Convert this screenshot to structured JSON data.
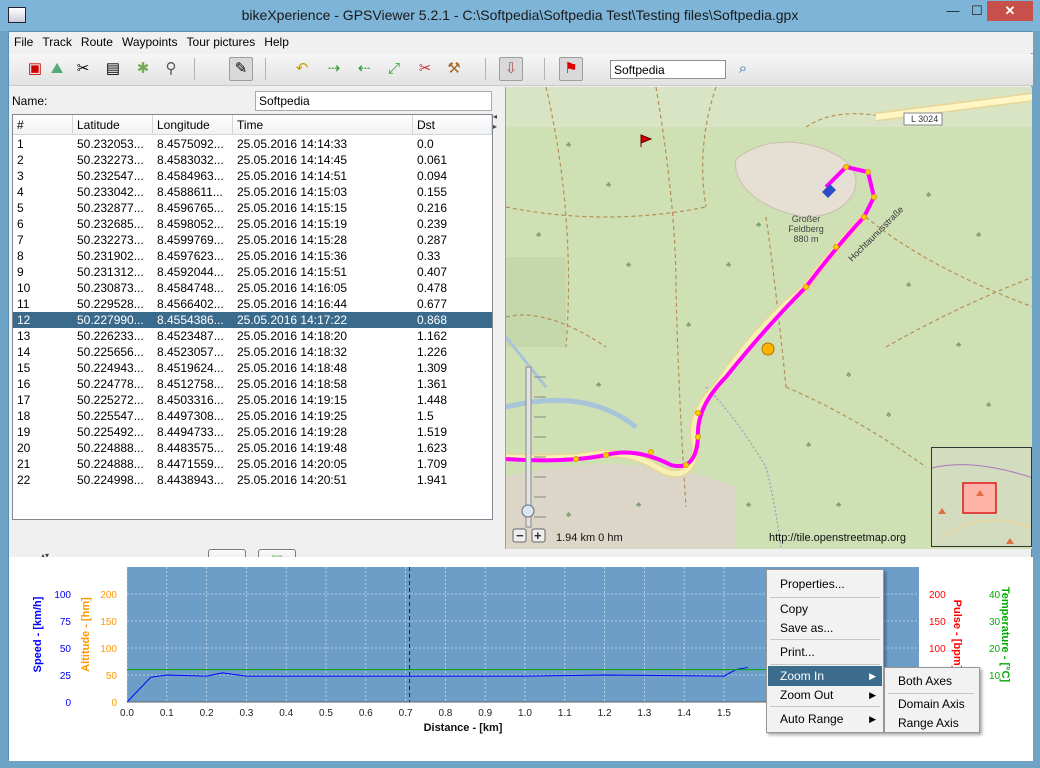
{
  "window": {
    "title": "bikeXperience - GPSViewer 5.2.1 - C:\\Softpedia\\Softpedia Test\\Testing files\\Softpedia.gpx",
    "minimize": "—",
    "maximize": "☐",
    "close": "✕"
  },
  "menubar": [
    "File",
    "Track",
    "Route",
    "Waypoints",
    "Tour pictures",
    "Help"
  ],
  "toolbar": {
    "search_value": "Softpedia"
  },
  "left_panel": {
    "name_label": "Name:",
    "name_value": "Softpedia"
  },
  "table": {
    "columns": [
      "#",
      "Latitude",
      "Longitude",
      "Time",
      "Dst"
    ],
    "selected_index": 11,
    "rows": [
      [
        "1",
        "50.232053...",
        "8.4575092...",
        "25.05.2016 14:14:33",
        "0.0"
      ],
      [
        "2",
        "50.232273...",
        "8.4583032...",
        "25.05.2016 14:14:45",
        "0.061"
      ],
      [
        "3",
        "50.232547...",
        "8.4584963...",
        "25.05.2016 14:14:51",
        "0.094"
      ],
      [
        "4",
        "50.233042...",
        "8.4588611...",
        "25.05.2016 14:15:03",
        "0.155"
      ],
      [
        "5",
        "50.232877...",
        "8.4596765...",
        "25.05.2016 14:15:15",
        "0.216"
      ],
      [
        "6",
        "50.232685...",
        "8.4598052...",
        "25.05.2016 14:15:19",
        "0.239"
      ],
      [
        "7",
        "50.232273...",
        "8.4599769...",
        "25.05.2016 14:15:28",
        "0.287"
      ],
      [
        "8",
        "50.231902...",
        "8.4597623...",
        "25.05.2016 14:15:36",
        "0.33"
      ],
      [
        "9",
        "50.231312...",
        "8.4592044...",
        "25.05.2016 14:15:51",
        "0.407"
      ],
      [
        "10",
        "50.230873...",
        "8.4584748...",
        "25.05.2016 14:16:05",
        "0.478"
      ],
      [
        "11",
        "50.229528...",
        "8.4566402...",
        "25.05.2016 14:16:44",
        "0.677"
      ],
      [
        "12",
        "50.227990...",
        "8.4554386...",
        "25.05.2016 14:17:22",
        "0.868"
      ],
      [
        "13",
        "50.226233...",
        "8.4523487...",
        "25.05.2016 14:18:20",
        "1.162"
      ],
      [
        "14",
        "50.225656...",
        "8.4523057...",
        "25.05.2016 14:18:32",
        "1.226"
      ],
      [
        "15",
        "50.224943...",
        "8.4519624...",
        "25.05.2016 14:18:48",
        "1.309"
      ],
      [
        "16",
        "50.224778...",
        "8.4512758...",
        "25.05.2016 14:18:58",
        "1.361"
      ],
      [
        "17",
        "50.225272...",
        "8.4503316...",
        "25.05.2016 14:19:15",
        "1.448"
      ],
      [
        "18",
        "50.225547...",
        "8.4497308...",
        "25.05.2016 14:19:25",
        "1.5"
      ],
      [
        "19",
        "50.225492...",
        "8.4494733...",
        "25.05.2016 14:19:28",
        "1.519"
      ],
      [
        "20",
        "50.224888...",
        "8.4483575...",
        "25.05.2016 14:19:48",
        "1.623"
      ],
      [
        "21",
        "50.224888...",
        "8.4471559...",
        "25.05.2016 14:20:05",
        "1.709"
      ],
      [
        "22",
        "50.224998...",
        "8.4438943...",
        "25.05.2016 14:20:51",
        "1.941"
      ]
    ]
  },
  "map": {
    "scale_label": "1.94 km 0 hm",
    "attribution": "http://tile.openstreetmap.org",
    "labels": {
      "peak": "Großer\nFeldberg\n880 m",
      "road": "L 3024",
      "street": "Hochtaunusstraße"
    }
  },
  "chart_data": {
    "type": "line",
    "xlabel": "Distance - [km]",
    "x_ticks": [
      "0.0",
      "0.1",
      "0.2",
      "0.3",
      "0.4",
      "0.5",
      "0.6",
      "0.7",
      "0.8",
      "0.9",
      "1.0",
      "1.1",
      "1.2",
      "1.3",
      "1.4",
      "1.5"
    ],
    "xlim": [
      0,
      1.99
    ],
    "left_axes": [
      {
        "label": "Speed - [km/h]",
        "color": "#0000ff",
        "ticks": [
          "0",
          "25",
          "50",
          "75",
          "100"
        ],
        "range": [
          0,
          125
        ]
      },
      {
        "label": "Altitude - [hm]",
        "color": "#ff9900",
        "ticks": [
          "0",
          "50",
          "100",
          "150",
          "200"
        ],
        "range": [
          0,
          250
        ]
      }
    ],
    "right_axes": [
      {
        "label": "Pulse - [bpm]",
        "color": "#ff0000",
        "ticks": [
          "200",
          "150",
          "100",
          "50"
        ],
        "range": [
          0,
          250
        ]
      },
      {
        "label": "Temperature - [°C]",
        "color": "#00aa00",
        "ticks": [
          "40",
          "30",
          "20",
          "10"
        ],
        "range": [
          0,
          50
        ]
      }
    ],
    "marker_x": 0.71,
    "series": [
      {
        "name": "Speed",
        "color": "#0000ff",
        "x": [
          0,
          0.06,
          0.1,
          0.2,
          0.24,
          0.3,
          0.5,
          0.7,
          1.0,
          1.2,
          1.5,
          1.53,
          1.56
        ],
        "y": [
          0,
          23,
          25,
          24,
          27,
          24,
          24,
          24,
          24,
          25,
          24,
          30,
          32
        ]
      },
      {
        "name": "Temperature",
        "color": "#00aa00",
        "x": [
          0,
          1.99
        ],
        "y": [
          12,
          12
        ]
      },
      {
        "name": "Altitude",
        "color": "#ff9900",
        "x": [
          0,
          1.99
        ],
        "y": [
          0,
          0
        ]
      }
    ]
  },
  "context_menu": {
    "items": [
      "Properties...",
      "Copy",
      "Save as...",
      "Print...",
      "Zoom In",
      "Zoom Out",
      "Auto Range"
    ],
    "submenu": [
      "Both Axes",
      "Domain Axis",
      "Range Axis"
    ]
  }
}
